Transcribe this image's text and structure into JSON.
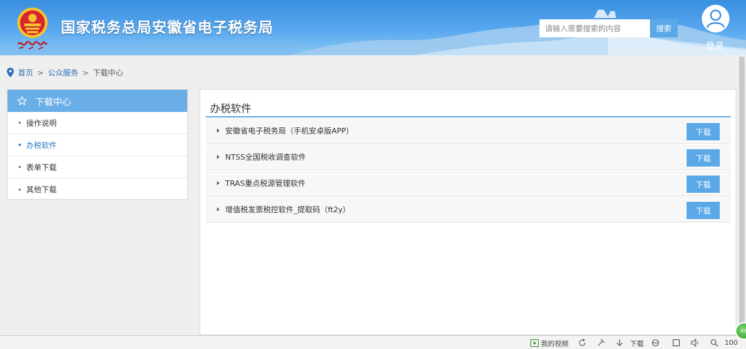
{
  "header": {
    "site_title": "国家税务总局安徽省电子税务局",
    "search_placeholder": "请输入需要搜索的内容",
    "search_button": "搜索",
    "login": "登录",
    "user_icon": "user-icon",
    "emblem_icon": "tax-emblem-icon"
  },
  "breadcrumb": {
    "icon": "location-pin-icon",
    "items": [
      "首页",
      "公众服务",
      "下载中心"
    ],
    "separator": ">"
  },
  "sidebar": {
    "title": "下载中心",
    "title_icon": "star-outline-icon",
    "items": [
      {
        "label": "操作说明",
        "active": false
      },
      {
        "label": "办税软件",
        "active": true
      },
      {
        "label": "表单下载",
        "active": false
      },
      {
        "label": "其他下载",
        "active": false
      }
    ]
  },
  "main": {
    "title": "办税软件",
    "rows": [
      {
        "name": "安徽省电子税务局（手机安卓版APP）",
        "button": "下载"
      },
      {
        "name": "NTSS全国税收调查软件",
        "button": "下载"
      },
      {
        "name": "TRAS重点税源管理软件",
        "button": "下载"
      },
      {
        "name": "增值税发票税控软件_提取码（ft2y）",
        "button": "下载"
      }
    ]
  },
  "statusbar": {
    "my_video": "我的视频",
    "download": "下载",
    "zoom": "100",
    "badge": "43"
  },
  "colors": {
    "accent": "#5aa8e8",
    "sidebar_header": "#6aaee8",
    "active_link": "#2a78c8"
  }
}
